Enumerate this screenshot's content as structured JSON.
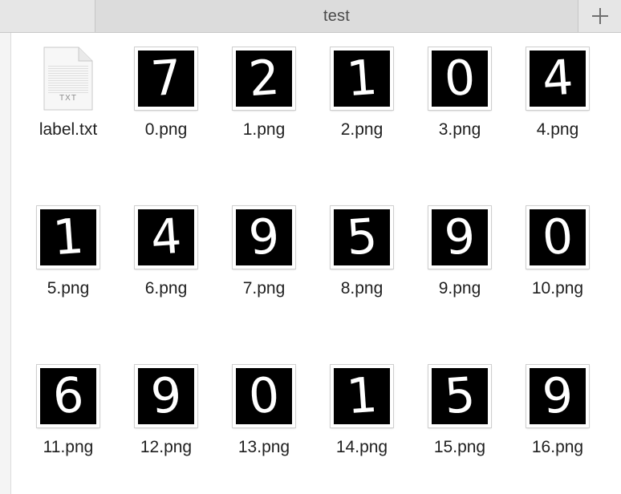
{
  "window": {
    "tab_title": "test",
    "new_tab_glyph": "+"
  },
  "files": [
    {
      "name": "label.txt",
      "kind": "text",
      "badge": "TXT",
      "icon": "txt-document-icon"
    },
    {
      "name": "0.png",
      "kind": "image",
      "digit": "7",
      "icon": "digit-7-thumbnail"
    },
    {
      "name": "1.png",
      "kind": "image",
      "digit": "2",
      "icon": "digit-2-thumbnail"
    },
    {
      "name": "2.png",
      "kind": "image",
      "digit": "1",
      "icon": "digit-1-thumbnail"
    },
    {
      "name": "3.png",
      "kind": "image",
      "digit": "0",
      "icon": "digit-0-thumbnail"
    },
    {
      "name": "4.png",
      "kind": "image",
      "digit": "4",
      "icon": "digit-4-thumbnail"
    },
    {
      "name": "5.png",
      "kind": "image",
      "digit": "1",
      "icon": "digit-1-thumbnail"
    },
    {
      "name": "6.png",
      "kind": "image",
      "digit": "4",
      "icon": "digit-4-thumbnail"
    },
    {
      "name": "7.png",
      "kind": "image",
      "digit": "9",
      "icon": "digit-9-thumbnail"
    },
    {
      "name": "8.png",
      "kind": "image",
      "digit": "5",
      "icon": "digit-5-thumbnail"
    },
    {
      "name": "9.png",
      "kind": "image",
      "digit": "9",
      "icon": "digit-9-thumbnail"
    },
    {
      "name": "10.png",
      "kind": "image",
      "digit": "0",
      "icon": "digit-0-thumbnail"
    },
    {
      "name": "11.png",
      "kind": "image",
      "digit": "6",
      "icon": "digit-6-thumbnail"
    },
    {
      "name": "12.png",
      "kind": "image",
      "digit": "9",
      "icon": "digit-9-thumbnail"
    },
    {
      "name": "13.png",
      "kind": "image",
      "digit": "0",
      "icon": "digit-0-thumbnail"
    },
    {
      "name": "14.png",
      "kind": "image",
      "digit": "1",
      "icon": "digit-1-thumbnail"
    },
    {
      "name": "15.png",
      "kind": "image",
      "digit": "5",
      "icon": "digit-5-thumbnail"
    },
    {
      "name": "16.png",
      "kind": "image",
      "digit": "9",
      "icon": "digit-9-thumbnail"
    }
  ],
  "colors": {
    "tab_bar": "#e3e3e3",
    "active_tab": "#dcdcdc",
    "thumbnail_background": "#000000",
    "digit_stroke": "#ffffff",
    "label_text": "#1f1f1f"
  }
}
